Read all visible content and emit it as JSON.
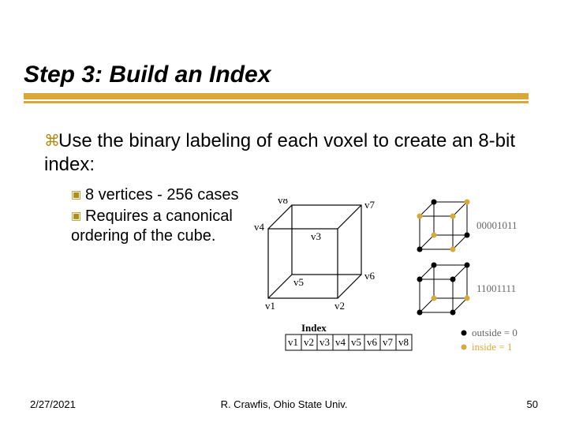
{
  "title": "Step 3: Build an Index",
  "body": "Use the binary labeling of each voxel to create an 8-bit index:",
  "sub1": "8 vertices - 256 cases",
  "sub2": "Requires a canonical ordering of the cube.",
  "cube_labels": {
    "v1": "v1",
    "v2": "v2",
    "v3": "v3",
    "v4": "v4",
    "v5": "v5",
    "v6": "v6",
    "v7": "v7",
    "v8": "v8"
  },
  "index_label": "Index",
  "index_cells": [
    "v1",
    "v2",
    "v3",
    "v4",
    "v5",
    "v6",
    "v7",
    "v8"
  ],
  "bits1": "00001011",
  "bits2": "11001111",
  "legend_out": "outside = 0",
  "legend_in": "inside = 1",
  "footer": {
    "date": "2/27/2021",
    "center": "R. Crawfis, Ohio State Univ.",
    "page": "50"
  }
}
